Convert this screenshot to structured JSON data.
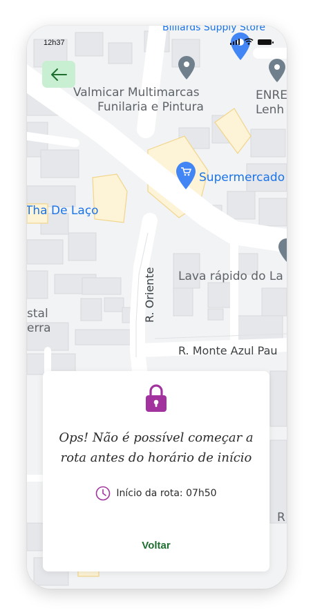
{
  "status_bar": {
    "time": "12h37"
  },
  "map": {
    "places": {
      "store": "Billiards Supply Store",
      "valmicar_line1": "Valmicar Multimarcas",
      "valmicar_line2": "Funilaria e Pintura",
      "enre_line1": "ENRE",
      "enre_line2": "Lenh",
      "supermercado": "Supermercado",
      "tha_de_laco": "Tha De Laço",
      "lava_rapido": "Lava rápido do La",
      "stal": "stal",
      "erra": "erra",
      "r_fragment": "R"
    },
    "streets": {
      "oriente": "R. Oriente",
      "monte_azul": "R. Monte Azul Pau"
    },
    "colors": {
      "background": "#f1f3f4",
      "block": "#e6e7ea",
      "road": "#ffffff",
      "highlight": "#fdf3d6",
      "pin_gray": "#707f8c",
      "pin_blue": "#4285f4",
      "label_gray": "#5f6368",
      "label_blue": "#1a73e8"
    }
  },
  "header": {
    "back_icon": "arrow-left-icon"
  },
  "modal": {
    "icon": "lock-icon",
    "message_line1": "Ops! Não é possível começar a",
    "message_line2": "rota antes do horário de início",
    "start_icon": "clock-icon",
    "start_label": "Início da rota: 07h50",
    "back_button": "Voltar"
  },
  "colors": {
    "accent_purple": "#a2339e",
    "button_green": "#1f6e2f",
    "back_button_bg": "#c9efd2"
  }
}
